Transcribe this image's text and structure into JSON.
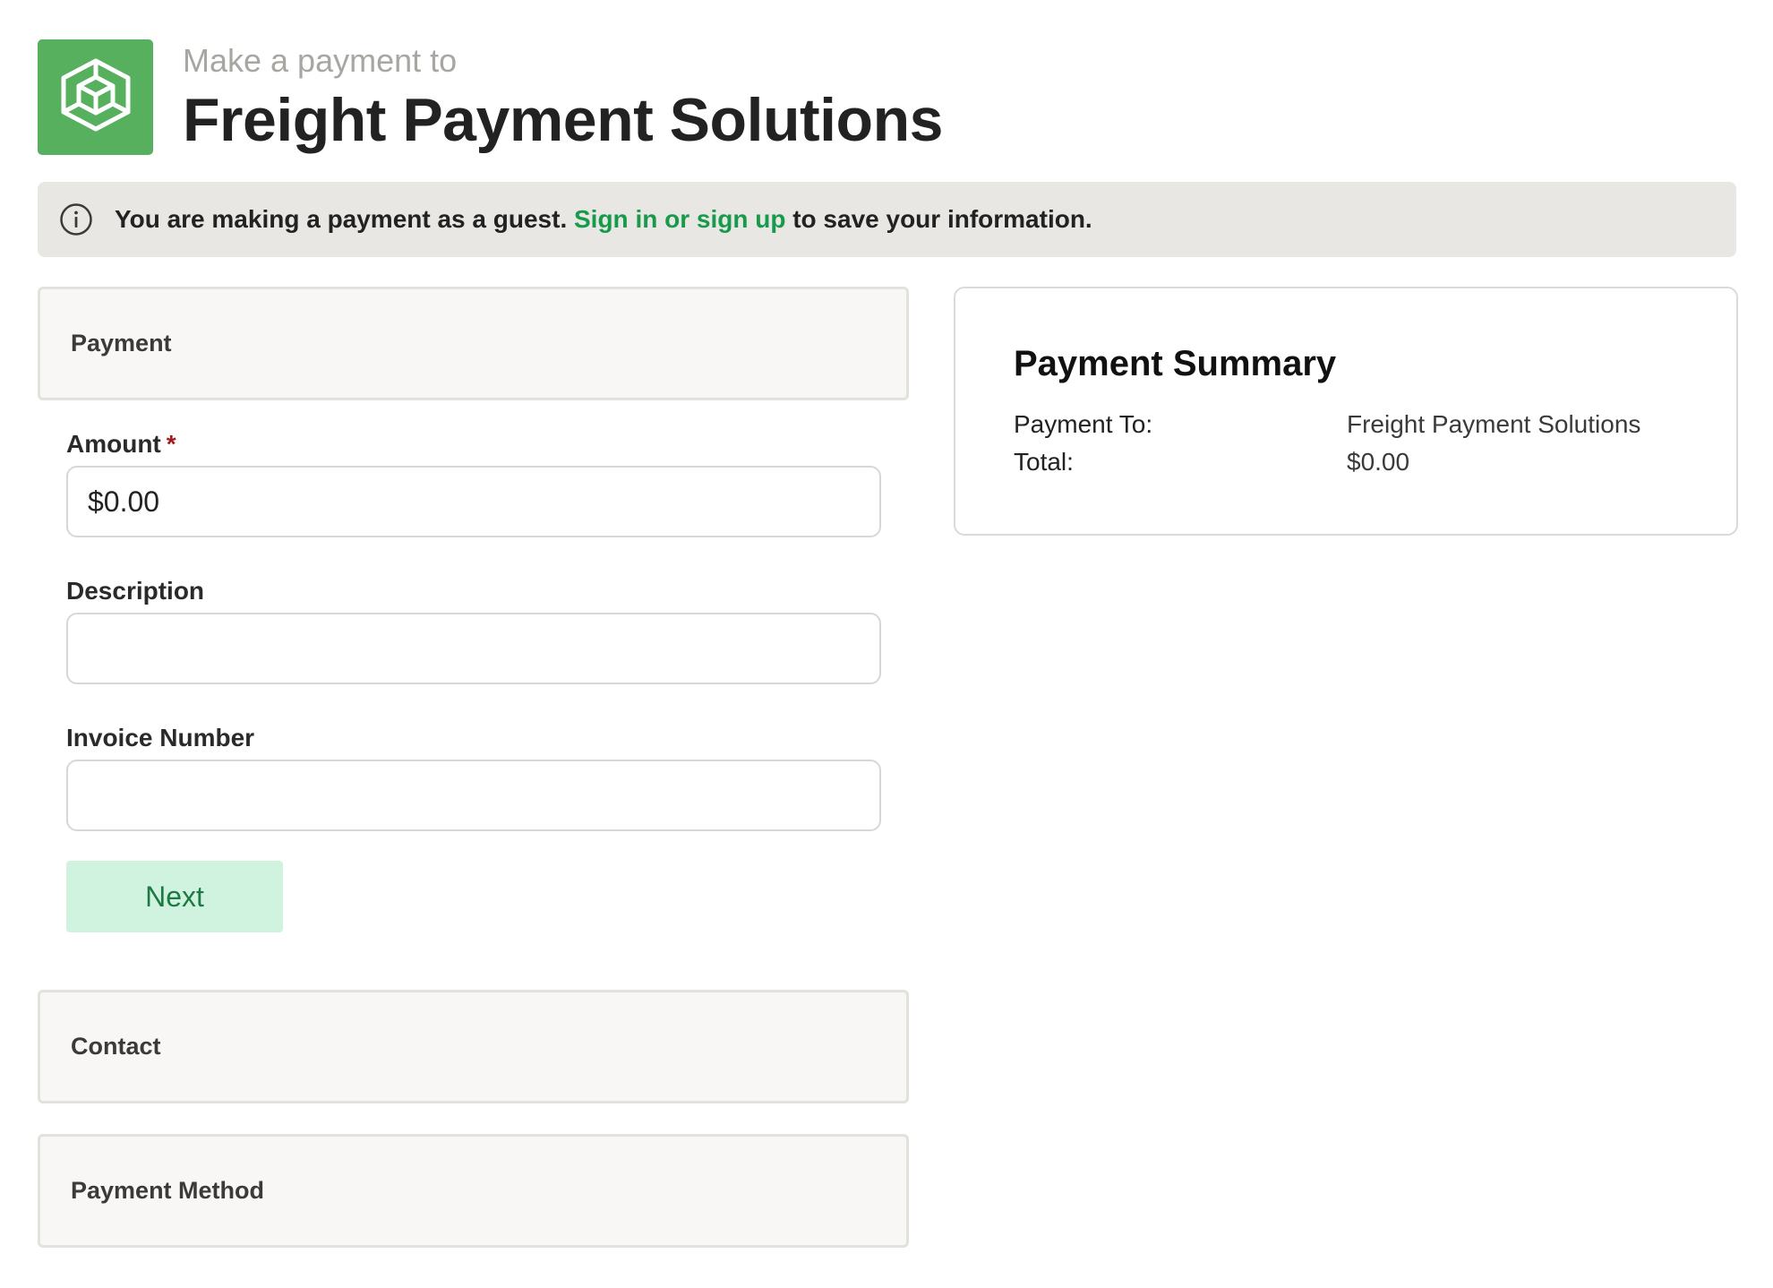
{
  "header": {
    "subtitle": "Make a payment to",
    "title": "Freight Payment Solutions",
    "logo_icon": "cube-icon",
    "logo_color": "#56b05d"
  },
  "banner": {
    "icon": "info-icon",
    "text_before": "You are making a payment as a guest. ",
    "link_text": "Sign in or sign up",
    "text_after": " to save your information.",
    "link_color": "#179a4b"
  },
  "sections": {
    "payment": "Payment",
    "contact": "Contact",
    "payment_method": "Payment Method"
  },
  "form": {
    "amount": {
      "label": "Amount",
      "required_mark": "*",
      "value": "$0.00"
    },
    "description": {
      "label": "Description",
      "value": ""
    },
    "invoice_number": {
      "label": "Invoice Number",
      "value": ""
    },
    "next_label": "Next"
  },
  "summary": {
    "title": "Payment Summary",
    "rows": [
      {
        "label": "Payment To:",
        "value": "Freight Payment Solutions"
      },
      {
        "label": "Total:",
        "value": "$0.00"
      }
    ]
  }
}
